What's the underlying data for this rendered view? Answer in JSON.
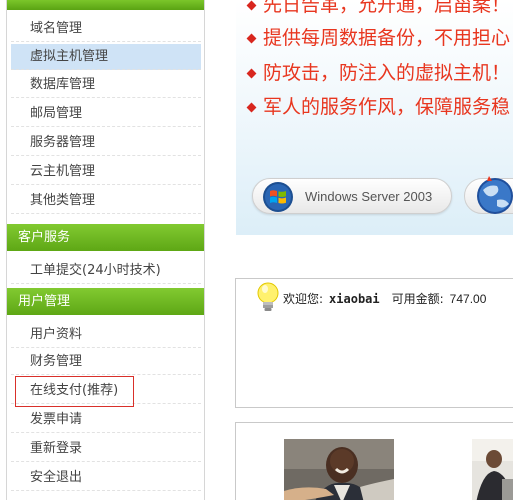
{
  "sidebar": {
    "host_items": [
      {
        "label": "域名管理"
      },
      {
        "label": "虚拟主机管理",
        "active": true
      },
      {
        "label": "数据库管理"
      },
      {
        "label": "邮局管理"
      },
      {
        "label": "服务器管理"
      },
      {
        "label": "云主机管理"
      },
      {
        "label": "其他类管理"
      }
    ],
    "customer_service": {
      "title": "客户服务",
      "items": [
        {
          "label": "工单提交(24小时技术)"
        }
      ]
    },
    "user_management": {
      "title": "用户管理",
      "items": [
        {
          "label": "用户资料"
        },
        {
          "label": "财务管理"
        },
        {
          "label": "在线支付(推荐)",
          "highlighted": true
        },
        {
          "label": "发票申请"
        },
        {
          "label": "重新登录"
        },
        {
          "label": "安全退出"
        }
      ]
    }
  },
  "banner": {
    "lines": [
      "先日告革，允开通，启甾案！",
      "提供每周数据备份，不用担心",
      "防攻击，防注入的虚拟主机！",
      "军人的服务作风，保障服务稳"
    ],
    "os_button": "Windows Server 2003"
  },
  "welcome": {
    "greeting": "欢迎您:",
    "username": "xiaobai",
    "balance_label": "可用金额:",
    "balance_value": "747.00"
  },
  "colors": {
    "sidebar_header": "#6cb81f",
    "active_item_bg": "#cfe3f6",
    "promo_text": "#e8361f",
    "highlight_border": "#d9302a"
  }
}
